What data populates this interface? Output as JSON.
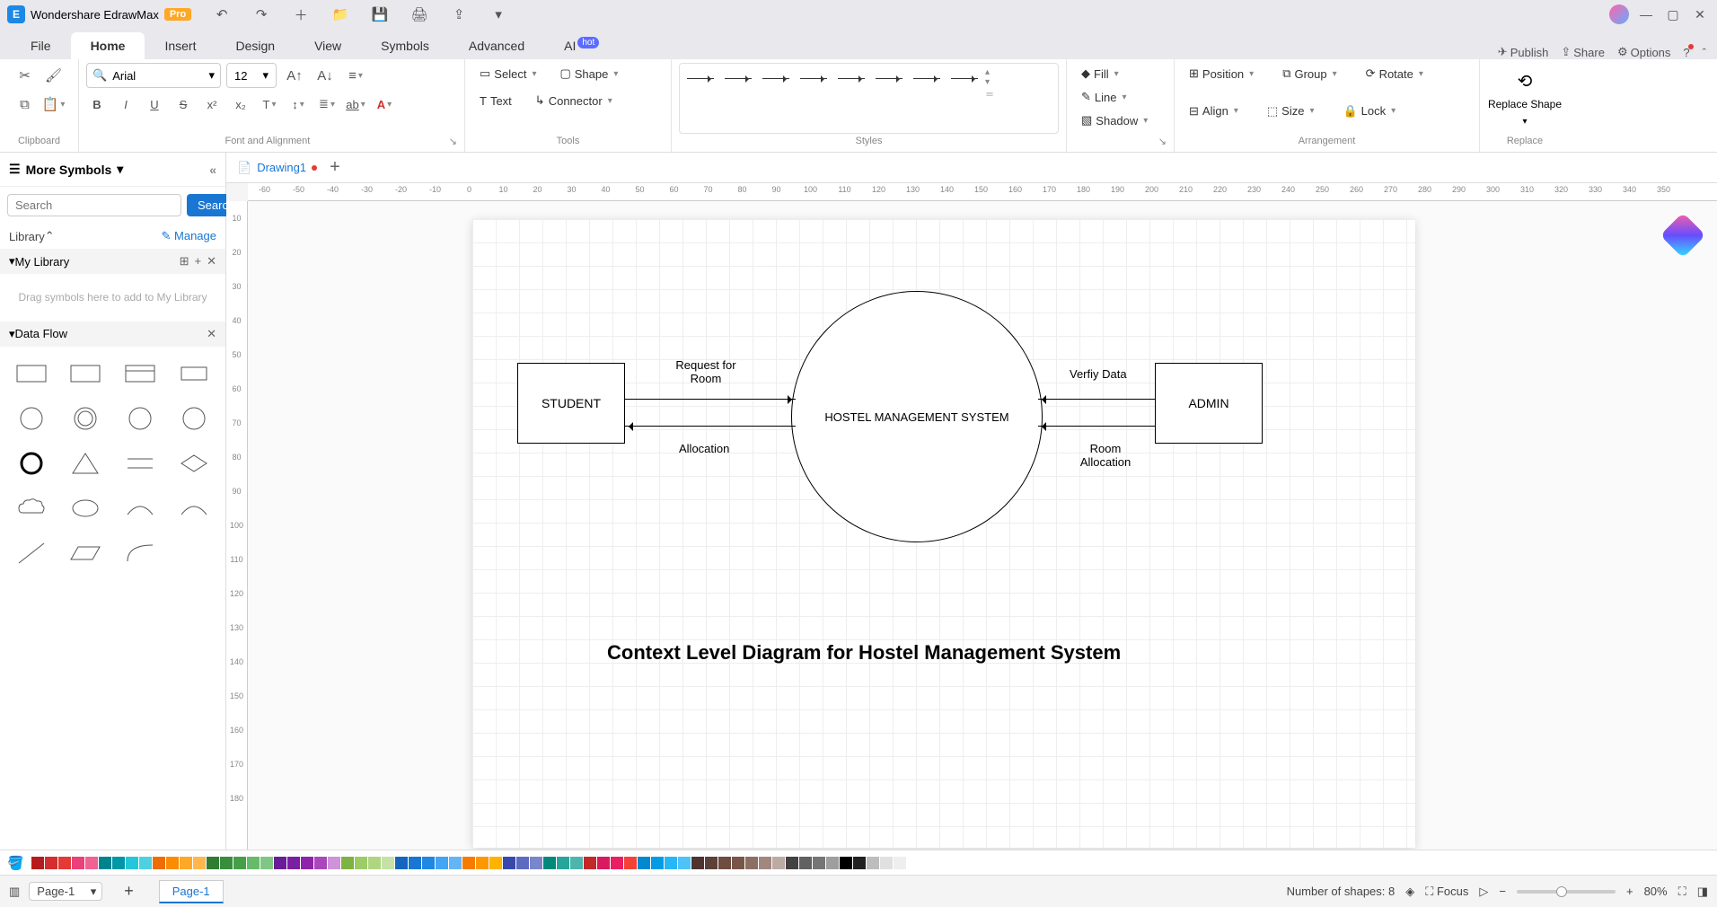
{
  "app": {
    "title": "Wondershare EdrawMax",
    "badge": "Pro"
  },
  "menu": {
    "tabs": [
      "File",
      "Home",
      "Insert",
      "Design",
      "View",
      "Symbols",
      "Advanced",
      "AI"
    ],
    "active": "Home",
    "hot": "hot",
    "publish": "Publish",
    "share": "Share",
    "options": "Options"
  },
  "ribbon": {
    "clipboard": "Clipboard",
    "font_name": "Arial",
    "font_size": "12",
    "font_alignment": "Font and Alignment",
    "select": "Select",
    "shape": "Shape",
    "text": "Text",
    "connector": "Connector",
    "tools": "Tools",
    "styles": "Styles",
    "fill": "Fill",
    "line": "Line",
    "shadow": "Shadow",
    "position": "Position",
    "group": "Group",
    "rotate": "Rotate",
    "align": "Align",
    "size": "Size",
    "lock": "Lock",
    "arrangement": "Arrangement",
    "replace_shape": "Replace Shape",
    "replace": "Replace"
  },
  "left": {
    "more_symbols": "More Symbols",
    "search_placeholder": "Search",
    "search_btn": "Search",
    "library": "Library",
    "manage": "Manage",
    "my_library": "My Library",
    "dropzone": "Drag symbols here to add to My Library",
    "data_flow": "Data Flow"
  },
  "doc": {
    "tab_name": "Drawing1",
    "ruler_h": [
      "-60",
      "-50",
      "-40",
      "-30",
      "-20",
      "-10",
      "0",
      "10",
      "20",
      "30",
      "40",
      "50",
      "60",
      "70",
      "80",
      "90",
      "100",
      "110",
      "120",
      "130",
      "140",
      "150",
      "160",
      "170",
      "180",
      "190",
      "200",
      "210",
      "220",
      "230",
      "240",
      "250",
      "260",
      "270",
      "280",
      "290",
      "300",
      "310",
      "320",
      "330",
      "340",
      "350"
    ],
    "ruler_v": [
      "10",
      "20",
      "30",
      "40",
      "50",
      "60",
      "70",
      "80",
      "90",
      "100",
      "110",
      "120",
      "130",
      "140",
      "150",
      "160",
      "170",
      "180"
    ]
  },
  "diagram": {
    "student": "STUDENT",
    "admin": "ADMIN",
    "process": "HOSTEL MANAGEMENT SYSTEM",
    "req_room": "Request for Room",
    "allocation": "Allocation",
    "verify": "Verfiy Data",
    "room_alloc": "Room Allocation",
    "title": "Context Level Diagram for Hostel Management System"
  },
  "colors": [
    "#b71c1c",
    "#d32f2f",
    "#e53935",
    "#ec407a",
    "#f06292",
    "#00838f",
    "#0097a7",
    "#26c6da",
    "#4dd0e1",
    "#ef6c00",
    "#fb8c00",
    "#ffa726",
    "#ffb74d",
    "#2e7d32",
    "#388e3c",
    "#43a047",
    "#66bb6a",
    "#81c784",
    "#6a1b9a",
    "#7b1fa2",
    "#8e24aa",
    "#ab47bc",
    "#ce93d8",
    "#7cb342",
    "#9ccc65",
    "#aed581",
    "#c5e1a5",
    "#1565c0",
    "#1976d2",
    "#1e88e5",
    "#42a5f5",
    "#64b5f6",
    "#f57c00",
    "#ff9800",
    "#ffb300",
    "#3949ab",
    "#5c6bc0",
    "#7986cb",
    "#00897b",
    "#26a69a",
    "#4db6ac",
    "#c62828",
    "#d81b60",
    "#e91e63",
    "#f44336",
    "#0288d1",
    "#039be5",
    "#29b6f6",
    "#4fc3f7",
    "#4e342e",
    "#5d4037",
    "#6d4c41",
    "#795548",
    "#8d6e63",
    "#a1887f",
    "#bcaaa4",
    "#424242",
    "#616161",
    "#757575",
    "#9e9e9e",
    "#000000",
    "#212121",
    "#bdbdbd",
    "#e0e0e0",
    "#eeeeee",
    "#ffffff"
  ],
  "status": {
    "page_sel": "Page-1",
    "page_tab": "Page-1",
    "shapes": "Number of shapes: 8",
    "focus": "Focus",
    "zoom": "80%"
  }
}
